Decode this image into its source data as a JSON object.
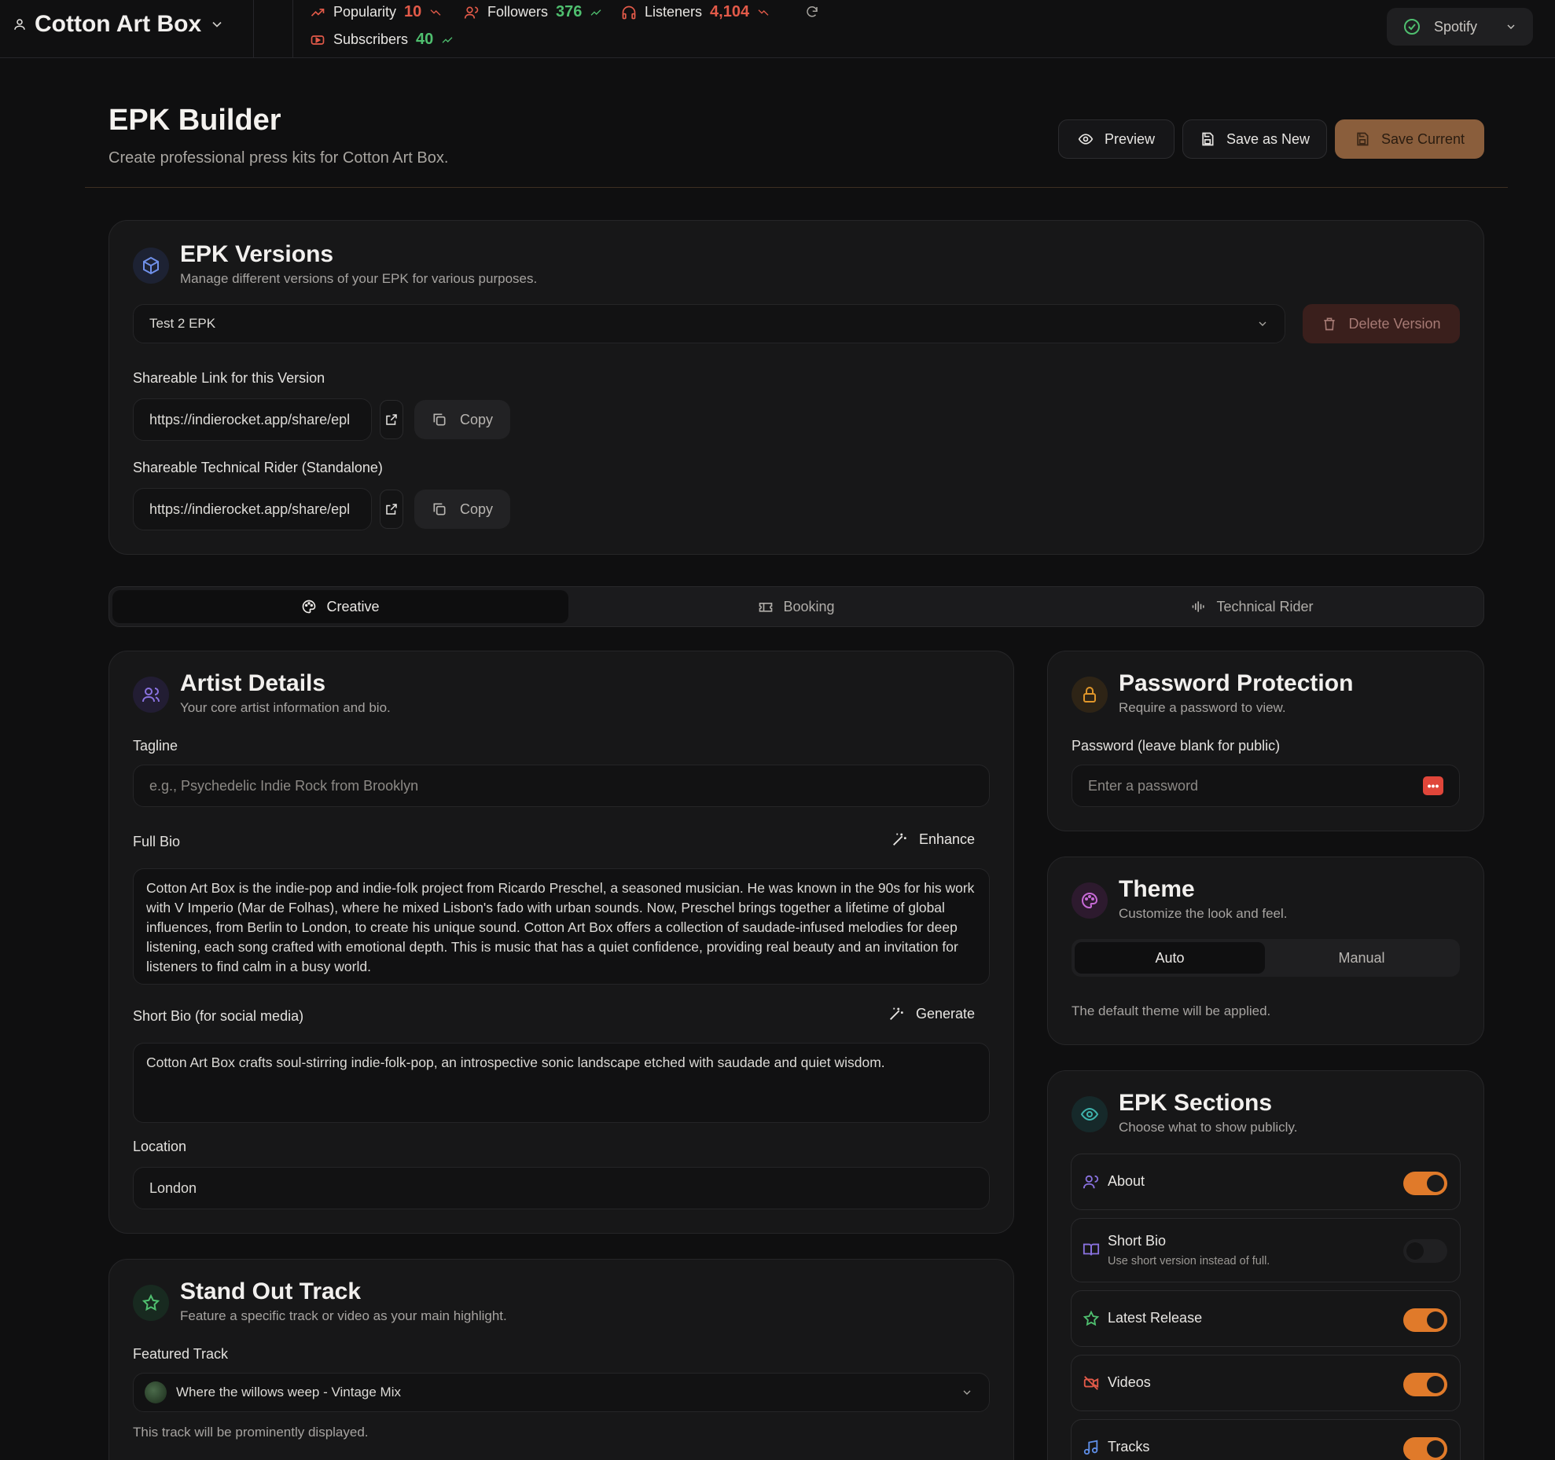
{
  "topbar": {
    "artist_name": "Cotton Art Box",
    "stats": {
      "popularity_label": "Popularity",
      "popularity_value": "10",
      "followers_label": "Followers",
      "followers_value": "376",
      "listeners_label": "Listeners",
      "listeners_value": "4,104",
      "subscribers_label": "Subscribers",
      "subscribers_value": "40"
    },
    "platform": "Spotify"
  },
  "header": {
    "title": "EPK Builder",
    "subtitle": "Create professional press kits for Cotton Art Box.",
    "preview_label": "Preview",
    "save_new_label": "Save as New",
    "save_current_label": "Save Current"
  },
  "versions": {
    "title": "EPK Versions",
    "subtitle": "Manage different versions of your EPK for various purposes.",
    "selected": "Test 2 EPK",
    "delete_label": "Delete Version",
    "link_label": "Shareable Link for this Version",
    "link_value": "https://indierocket.app/share/epl",
    "rider_label": "Shareable Technical Rider (Standalone)",
    "rider_value": "https://indierocket.app/share/epl",
    "copy_label": "Copy"
  },
  "tabs": [
    "Creative",
    "Booking",
    "Technical Rider"
  ],
  "artist_details": {
    "title": "Artist Details",
    "subtitle": "Your core artist information and bio.",
    "tagline_label": "Tagline",
    "tagline_placeholder": "e.g., Psychedelic Indie Rock from Brooklyn",
    "full_bio_label": "Full Bio",
    "enhance_label": "Enhance",
    "full_bio": "Cotton Art Box is the indie-pop and indie-folk project from Ricardo Preschel, a seasoned musician. He was known in the 90s for his work with V Imperio (Mar de Folhas), where he mixed Lisbon's fado with urban sounds. Now, Preschel brings together a lifetime of global influences, from Berlin to London, to create his unique sound. Cotton Art Box offers a collection of saudade-infused melodies for deep listening, each song crafted with emotional depth. This is music that has a quiet confidence, providing real beauty and an invitation for listeners to find calm in a busy world.",
    "short_bio_label": "Short Bio (for social media)",
    "generate_label": "Generate",
    "short_bio": "Cotton Art Box crafts soul-stirring indie-folk-pop, an introspective sonic landscape etched with saudade and quiet wisdom.",
    "location_label": "Location",
    "location_value": "London"
  },
  "stand_out": {
    "title": "Stand Out Track",
    "subtitle": "Feature a specific track or video as your main highlight.",
    "featured_label": "Featured Track",
    "featured_value": "Where the willows weep - Vintage Mix",
    "help": "This track will be prominently displayed."
  },
  "password": {
    "title": "Password Protection",
    "subtitle": "Require a password to view.",
    "field_label": "Password (leave blank for public)",
    "placeholder": "Enter a password"
  },
  "theme": {
    "title": "Theme",
    "subtitle": "Customize the look and feel.",
    "options": [
      "Auto",
      "Manual"
    ],
    "selected": "Auto",
    "note": "The default theme will be applied."
  },
  "sections": {
    "title": "EPK Sections",
    "subtitle": "Choose what to show publicly.",
    "items": [
      {
        "label": "About",
        "enabled": true
      },
      {
        "label": "Short Bio",
        "description": "Use short version instead of full.",
        "enabled": false
      },
      {
        "label": "Latest Release",
        "enabled": true
      },
      {
        "label": "Videos",
        "enabled": true
      },
      {
        "label": "Tracks",
        "enabled": true
      }
    ]
  },
  "colors": {
    "accent": "#e07a2a",
    "stat_down": "#e35a49",
    "stat_up": "#4fbf6f",
    "save_current_bg": "#8a5e3c"
  }
}
